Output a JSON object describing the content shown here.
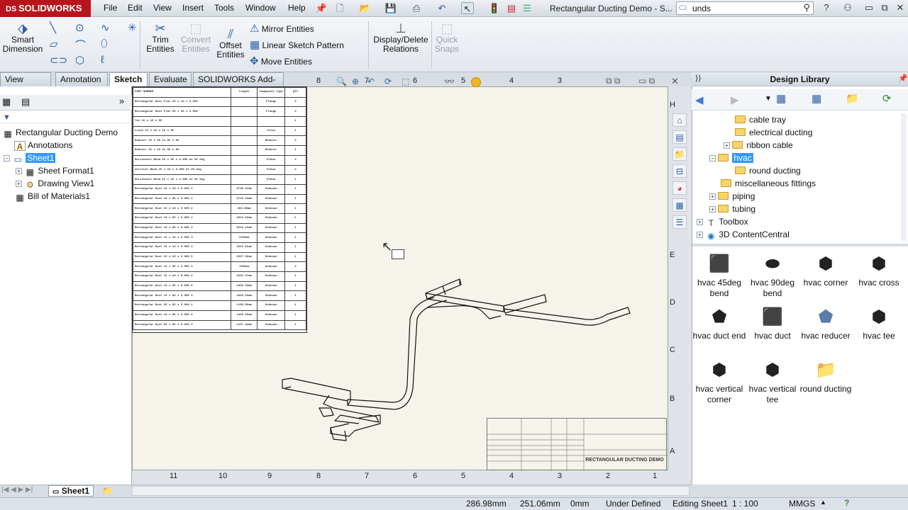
{
  "app": {
    "brand": "SOLIDWORKS",
    "brand_prefix": "DS",
    "window_title": "Rectangular Ducting Demo - S..."
  },
  "menu": [
    "File",
    "Edit",
    "View",
    "Insert",
    "Tools",
    "Window",
    "Help"
  ],
  "search": {
    "value": "unds"
  },
  "ribbon": {
    "smart_dimension": "Smart Dimension",
    "trim_entities": "Trim Entities",
    "convert_entities": "Convert Entities",
    "offset_entities": "Offset Entities",
    "mirror_entities": "Mirror Entities",
    "linear_sketch_pattern": "Linear Sketch Pattern",
    "move_entities": "Move Entities",
    "display_delete_relations": "Display/Delete Relations",
    "quick_snaps": "Quick Snaps"
  },
  "tabs": [
    "View Layout",
    "Annotation",
    "Sketch",
    "Evaluate",
    "SOLIDWORKS Add-Ins"
  ],
  "active_tab": "Sketch",
  "feature_tree": {
    "root": "Rectangular Ducting Demo",
    "items": [
      "Annotations",
      "Sheet1",
      "Sheet Format1",
      "Drawing View1",
      "Bill of Materials1"
    ]
  },
  "bom": {
    "headers": [
      "PART NUMBER",
      "Length",
      "Component Type",
      "QTY"
    ],
    "rows": [
      [
        "Rectangular Duct Flat 15 x 10 x 0.000",
        "",
        "Flange",
        "2"
      ],
      [
        "Rectangular Duct Flat 05 x 05 x 0.000",
        "",
        "Flange",
        "2"
      ],
      [
        "Tee 15 x 10 x 05",
        "",
        "",
        "1"
      ],
      [
        "Cross 15 x 10 x 10 x 05",
        "",
        "Cross",
        "1"
      ],
      [
        "Reducer 10 x 05 to 05 x 05",
        "",
        "Reducer",
        "2"
      ],
      [
        "Reducer 15 x 10 to 05 x 05",
        "",
        "Reducer",
        "1"
      ],
      [
        "Horizontal Bend 10 x 05 x 0.000 at 90 deg",
        "",
        "Elbow",
        "4"
      ],
      [
        "Vertical Bend 15 x 10 x 0.000 at 90 deg",
        "",
        "Elbow",
        "2"
      ],
      [
        "Horizontal Bend 15 x 10 x 0.000 at 90 deg",
        "",
        "Elbow",
        "1"
      ],
      [
        "Rectangular Duct 15 x 10 x 0.000 1",
        "5795.47mm",
        "Unknown",
        "1"
      ],
      [
        "Rectangular Duct 10 x 05 x 0.000 1",
        "2726.24mm",
        "Unknown",
        "1"
      ],
      [
        "Rectangular Duct 15 x 10 x 0.000 2",
        "463.80mm",
        "Unknown",
        "1"
      ],
      [
        "Rectangular Duct 10 x 05 x 0.000 2",
        "4316.62mm",
        "Unknown",
        "1"
      ],
      [
        "Rectangular Duct 10 x 05 x 0.000 3",
        "5644.16mm",
        "Unknown",
        "1"
      ],
      [
        "Rectangular Duct 15 x 10 x 0.000 3",
        "3750mm",
        "Unknown",
        "1"
      ],
      [
        "Rectangular Duct 15 x 10 x 0.000 4",
        "3413.81mm",
        "Unknown",
        "1"
      ],
      [
        "Rectangular Duct 15 x 10 x 0.000 5",
        "2627.06mm",
        "Unknown",
        "1"
      ],
      [
        "Rectangular Duct 10 x 05 x 0.000 4",
        "7500mm",
        "Unknown",
        "2"
      ],
      [
        "Rectangular Duct 15 x 10 x 0.000 6",
        "1692.47mm",
        "Unknown",
        "1"
      ],
      [
        "Rectangular Duct 10 x 05 x 0.000 5",
        "1456.34mm",
        "Unknown",
        "1"
      ],
      [
        "Rectangular Duct 10 x 05 x 0.000 6",
        "1865.64mm",
        "Unknown",
        "1"
      ],
      [
        "Rectangular Duct 05 x 05 x 0.000 1",
        "1195.06mm",
        "Unknown",
        "1"
      ],
      [
        "Rectangular Duct 10 x 05 x 0.000 8",
        "1406.56mm",
        "Unknown",
        "1"
      ],
      [
        "Rectangular Duct 05 x 05 x 0.000 3",
        "1167.44mm",
        "Unknown",
        "1"
      ]
    ]
  },
  "sheet": {
    "top_zones": [
      "8",
      "7",
      "6",
      "5",
      "4",
      "3"
    ],
    "bottom_zones": [
      "11",
      "10",
      "9",
      "8",
      "7",
      "6",
      "5",
      "4",
      "3",
      "2",
      "1"
    ],
    "right_zones": [
      "H",
      "E",
      "D",
      "C",
      "B",
      "A"
    ],
    "title_block_text": "RECTANGULAR DUCTING DEMO"
  },
  "design_library": {
    "title": "Design Library",
    "tree": [
      "cable tray",
      "electrical ducting",
      "ribbon cable",
      "hvac",
      "round ducting",
      "miscellaneous fittings",
      "piping",
      "tubing",
      "Toolbox",
      "3D ContentCentral"
    ],
    "selected": "hvac",
    "items": [
      {
        "label": "hvac 45deg bend",
        "icon": "hvac-45deg-bend-icon"
      },
      {
        "label": "hvac 90deg bend",
        "icon": "hvac-90deg-bend-icon"
      },
      {
        "label": "hvac corner",
        "icon": "hvac-corner-icon"
      },
      {
        "label": "hvac cross",
        "icon": "hvac-cross-icon"
      },
      {
        "label": "hvac duct end",
        "icon": "hvac-duct-end-icon"
      },
      {
        "label": "hvac duct",
        "icon": "hvac-duct-icon"
      },
      {
        "label": "hvac reducer",
        "icon": "hvac-reducer-icon"
      },
      {
        "label": "hvac tee",
        "icon": "hvac-tee-icon"
      },
      {
        "label": "hvac vertical corner",
        "icon": "hvac-vertical-corner-icon"
      },
      {
        "label": "hvac vertical tee",
        "icon": "hvac-vertical-tee-icon"
      },
      {
        "label": "round ducting",
        "icon": "folder-icon"
      }
    ]
  },
  "sheet_tab": "Sheet1",
  "status": {
    "x": "286.98mm",
    "y": "251.06mm",
    "z": "0mm",
    "state": "Under Defined",
    "editing": "Editing Sheet1",
    "scale": "1 : 100",
    "units": "MMGS"
  },
  "colors": {
    "brand_red": "#b8141c",
    "selection_blue": "#3399ff",
    "sheet_bg": "#f6f3ea"
  }
}
